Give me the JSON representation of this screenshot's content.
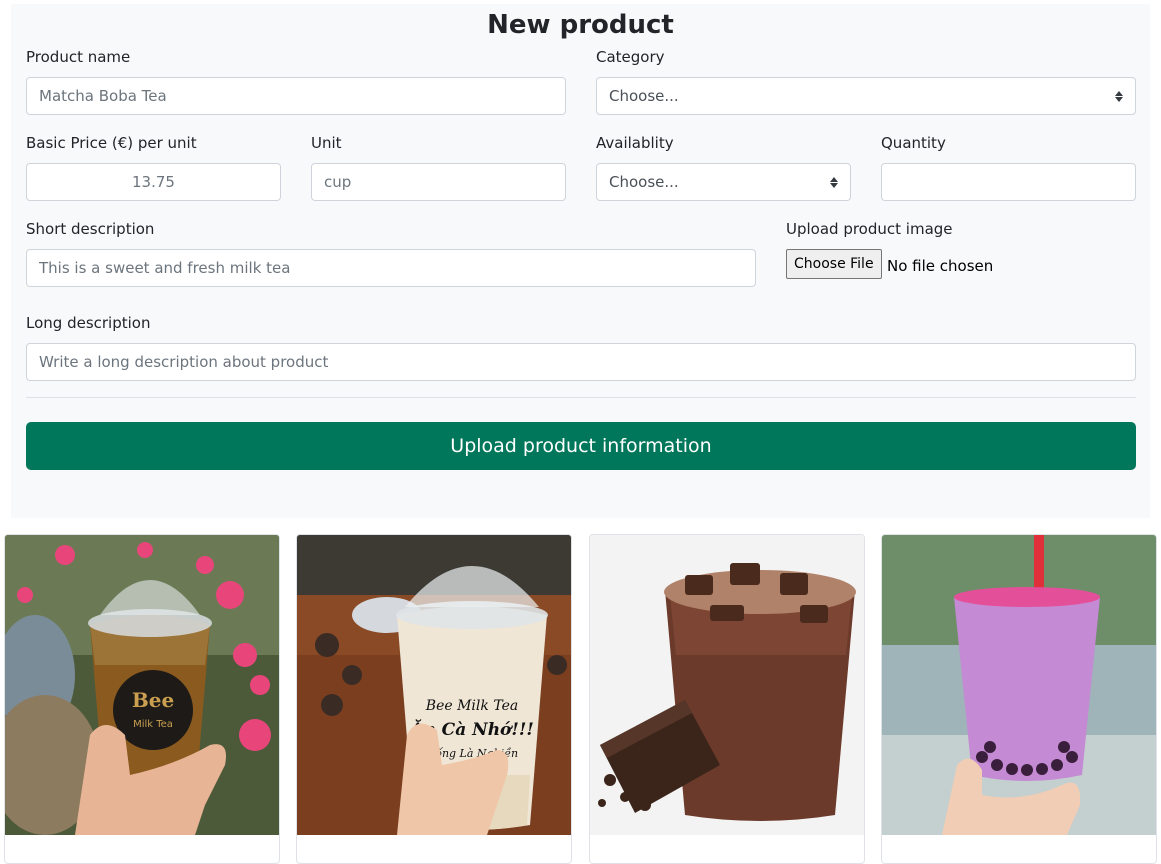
{
  "form": {
    "title": "New product",
    "product_name": {
      "label": "Product name",
      "placeholder": "Matcha Boba Tea"
    },
    "category": {
      "label": "Category",
      "selected": "Choose..."
    },
    "price": {
      "label": "Basic Price (€) per unit",
      "placeholder": "13.75"
    },
    "unit": {
      "label": "Unit",
      "placeholder": "cup"
    },
    "availability": {
      "label": "Availablity",
      "selected": "Choose..."
    },
    "quantity": {
      "label": "Quantity",
      "value": ""
    },
    "short_description": {
      "label": "Short description",
      "placeholder": "This is a sweet and fresh milk tea"
    },
    "upload_image": {
      "label": "Upload product image",
      "button": "Choose File",
      "status": "No file chosen"
    },
    "long_description": {
      "label": "Long description",
      "placeholder": "Write a long description about product"
    },
    "submit_label": "Upload product information"
  },
  "products": [
    {
      "cup_text": [
        "Bee",
        "Milk Tea"
      ]
    },
    {
      "cup_text": [
        "Bee Milk Tea",
        "Ăn Cà Nhớ!!!",
        "Uống Là Nghiền"
      ]
    },
    {
      "cup_text": []
    },
    {
      "cup_text": []
    }
  ]
}
